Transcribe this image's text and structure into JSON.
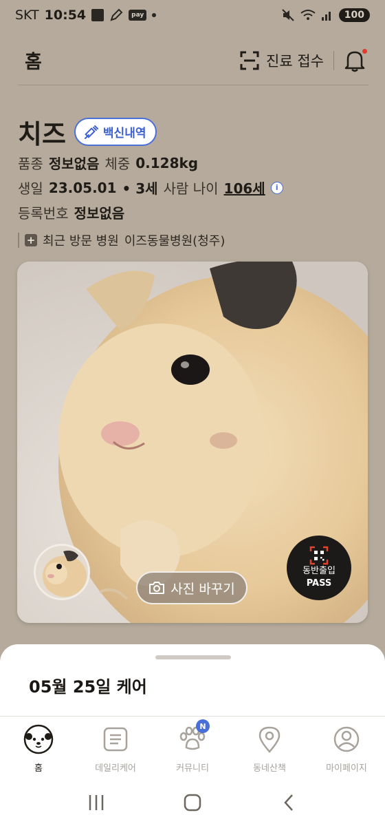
{
  "status_bar": {
    "carrier": "SKT",
    "time": "10:54",
    "pay_label": "pay",
    "battery": "100"
  },
  "header": {
    "title": "홈",
    "scan_label": "진료 접수"
  },
  "pet": {
    "name": "치즈",
    "vaccine_label": "백신내역",
    "breed_label": "품종",
    "breed_value": "정보없음",
    "weight_label": "체중",
    "weight_value": "0.128kg",
    "birth_label": "생일",
    "birth_value": "23.05.01",
    "age_value": "• 3세",
    "human_age_label": "사람 나이",
    "human_age_value": "106세",
    "info_icon_glyph": "i",
    "reg_label": "등록번호",
    "reg_value": "정보없음",
    "recent_label": "최근 방문 병원",
    "recent_value": "이즈동물병원(청주)",
    "recent_icon_glyph": "+"
  },
  "photo": {
    "change_label": "사진 바꾸기",
    "pass_line1": "동반출입",
    "pass_line2": "PASS"
  },
  "sheet": {
    "title": "05월 25일 케어"
  },
  "bottom_nav": {
    "items": [
      {
        "label": "홈",
        "icon": "home-dog-icon",
        "active": true
      },
      {
        "label": "데일리케어",
        "icon": "daily-list-icon",
        "active": false
      },
      {
        "label": "커뮤니티",
        "icon": "paw-icon",
        "active": false,
        "badge": "N"
      },
      {
        "label": "동네산책",
        "icon": "location-pin-icon",
        "active": false
      },
      {
        "label": "마이페이지",
        "icon": "person-icon",
        "active": false
      }
    ]
  },
  "colors": {
    "background": "#b5aa9b",
    "accent": "#4a6fd6",
    "notification_dot": "#e23b2e"
  }
}
